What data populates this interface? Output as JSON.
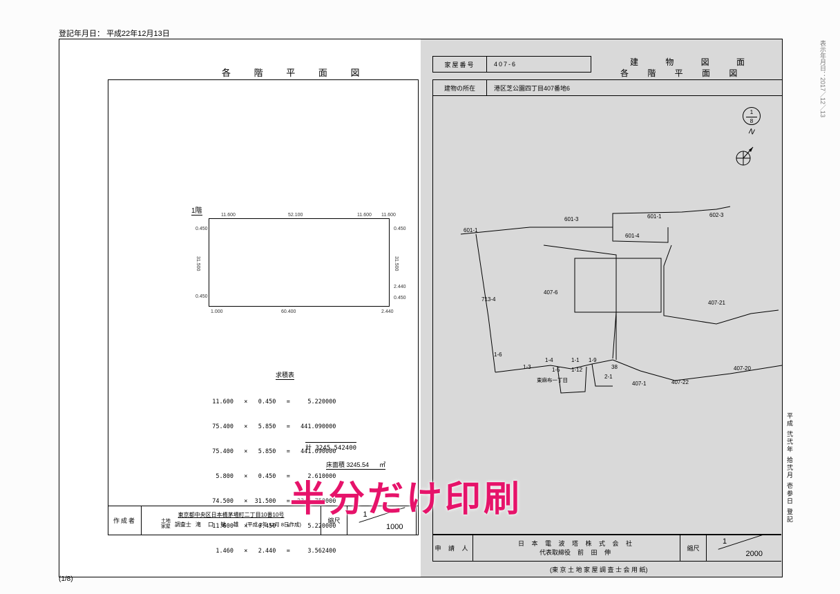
{
  "header": {
    "registration_date_label": "登記年月日：",
    "registration_date_value": "平成22年12月13日"
  },
  "left": {
    "title": "各 階 平 面 図",
    "floor_label": "1階",
    "dims": {
      "top_left": "11.600",
      "top_right": "52.100",
      "tr_small1": "11.600",
      "tr_small2": "11.600",
      "left_top": "0.450",
      "right_top": "0.450",
      "left_mid": "31.500",
      "right_mid": "31.500",
      "left_bot": "0.450",
      "right_bot1": "2.440",
      "right_bot2": "0.450",
      "bot_left": "1.000",
      "bot_main": "60.400",
      "bot_right": "2.440"
    },
    "calc_title": "求積表",
    "calc_rows": [
      "  11.600   ×   0.450   =     5.220000",
      "  75.400   ×   5.850   =   441.090000",
      "  75.400   ×   5.850   =   441.090000",
      "   5.800   ×   0.450   =     2.610000",
      "  74.500   ×  31.500   =  2346.750000",
      "  11.600   ×   0.450   =     5.220000",
      "   1.460   ×   2.440   =     3.562400"
    ],
    "calc_total_label": "計",
    "calc_total_value": "3245.542400",
    "floor_area_label": "床面積",
    "floor_area_value": "3245.54",
    "floor_area_unit": "㎡",
    "footer": {
      "author_label": "作成者",
      "address": "東京都中央区日本橋茅場町二丁目10番10号",
      "surveyor_prefix": "土地\n家屋",
      "surveyor_label": "調査士",
      "surveyor_name": "滝 口  敏 雄",
      "created_date": "(平成  2年  12月  8日作成)",
      "scale_label": "縮尺",
      "scale_num": "1",
      "scale_den": "1000"
    }
  },
  "right": {
    "title1": "建  物  図  面",
    "title2": "各 階 平 面 図",
    "house_number_label": "家屋番号",
    "house_number_value": "407-6",
    "location_label": "建物の所在",
    "location_value": "港区芝公園四丁目407番地6",
    "page_fraction_num": "1",
    "page_fraction_den": "8",
    "lots": {
      "601_1": "601-1",
      "601_3": "601-3",
      "601_4": "601-4",
      "602_3": "602-3",
      "601_1b": "601-1",
      "713_4": "713-4",
      "407_6": "407-6",
      "407_21": "407-21",
      "407_20": "407-20",
      "407_22": "407-22",
      "407_1": "407-1",
      "1_3": "1-3",
      "1_4": "1-4",
      "1_5": "1-5",
      "1_6": "1-6",
      "1_1": "1-1",
      "1_12": "1-12",
      "1_9": "1-9",
      "2_1": "2-1",
      "38": "38",
      "area_label": "東麻布一丁目"
    },
    "footer": {
      "applicant_label": "申 請 人",
      "company": "日 本 電 波 塔 株 式 会 社",
      "rep_title": "代表取締役",
      "rep_name": "前  田    伸",
      "scale_label": "縮尺",
      "scale_num": "1",
      "scale_den": "2000",
      "form_note": "(東 京 土 地 家 屋 調 査 士 会 用 紙)"
    },
    "side_text": "平成 弐弐年 拾弐月 壱参日 登記"
  },
  "page_number": "(1/8)",
  "overlay_text": "半分だけ印刷",
  "side_print_date": "表示年月日：2017／12／13"
}
